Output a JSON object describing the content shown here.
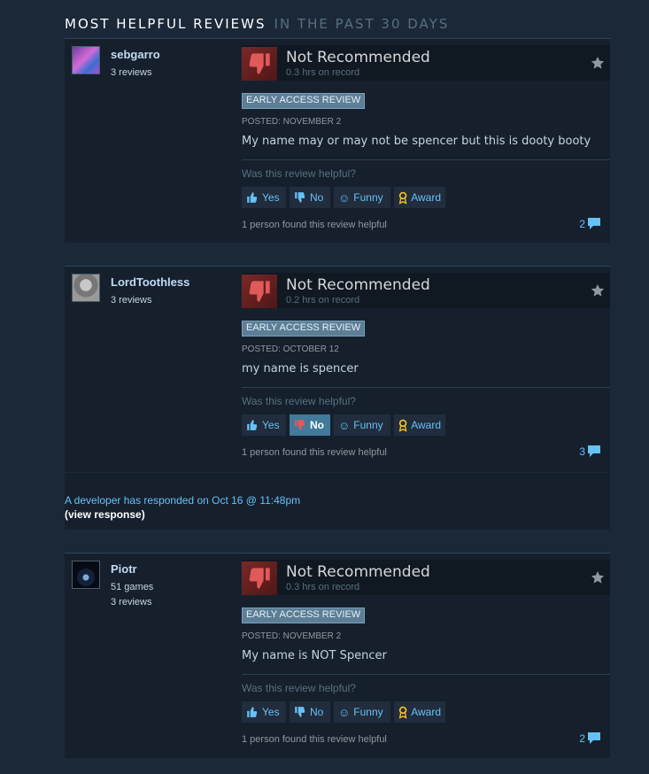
{
  "header": {
    "title": "Most Helpful Reviews",
    "subtitle": "In the past 30 days"
  },
  "reviews": [
    {
      "author": "sebgarro",
      "stats": [
        "3 reviews"
      ],
      "verdict": "Not Recommended",
      "hours": "0.3 hrs on record",
      "badge": "EARLY ACCESS REVIEW",
      "posted": "POSTED: NOVEMBER 2",
      "text": "My name may or may not be spencer but this is dooty booty",
      "helpful_question": "Was this review helpful?",
      "buttons": {
        "yes": "Yes",
        "no": "No",
        "funny": "Funny",
        "award": "Award"
      },
      "selected_vote": "",
      "found_helpful": "1 person found this review helpful",
      "comment_count": "2"
    },
    {
      "author": "LordToothless",
      "stats": [
        "3 reviews"
      ],
      "verdict": "Not Recommended",
      "hours": "0.2 hrs on record",
      "badge": "EARLY ACCESS REVIEW",
      "posted": "POSTED: OCTOBER 12",
      "text": "my name is spencer",
      "helpful_question": "Was this review helpful?",
      "buttons": {
        "yes": "Yes",
        "no": "No",
        "funny": "Funny",
        "award": "Award"
      },
      "selected_vote": "no",
      "found_helpful": "1 person found this review helpful",
      "comment_count": "3"
    },
    {
      "author": "Piotr",
      "stats": [
        "51 games",
        "3 reviews"
      ],
      "verdict": "Not Recommended",
      "hours": "0.3 hrs on record",
      "badge": "EARLY ACCESS REVIEW",
      "posted": "POSTED: NOVEMBER 2",
      "text": "My name is NOT Spencer",
      "helpful_question": "Was this review helpful?",
      "buttons": {
        "yes": "Yes",
        "no": "No",
        "funny": "Funny",
        "award": "Award"
      },
      "selected_vote": "",
      "found_helpful": "1 person found this review helpful",
      "comment_count": "2"
    }
  ],
  "developer_response": {
    "text": "A developer has responded on Oct 16 @ 11:48pm",
    "link": "(view response)"
  },
  "icons": {
    "thumb": "thumbs-down-icon",
    "star": "star-icon",
    "comment": "comment-icon",
    "funny": "smiley-icon",
    "award": "award-icon"
  },
  "colors": {
    "background": "#1b2838",
    "panel": "#16202d",
    "accent": "#67c1f5",
    "negative": "#7a2828",
    "selected": "#417a9b"
  }
}
